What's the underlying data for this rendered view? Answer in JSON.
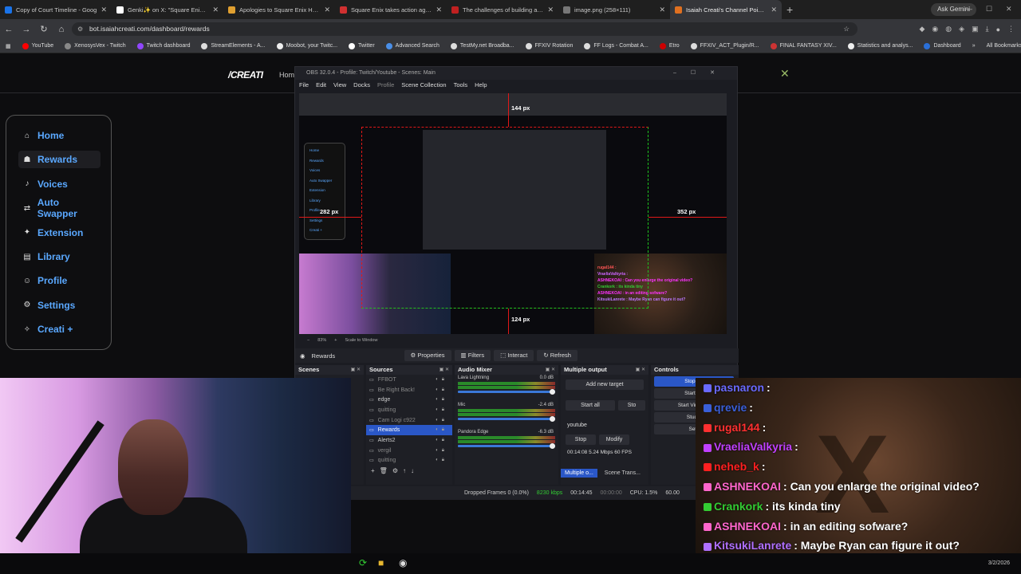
{
  "browser": {
    "tabs": [
      {
        "title": "Copy of Court Timeline - Goog",
        "color": "#1a73e8"
      },
      {
        "title": "Genki✨ on X: \"Square Enix ha",
        "color": "#ffffff"
      },
      {
        "title": "Apologies to Square Enix Holdi",
        "color": "#e0a030"
      },
      {
        "title": "Square Enix takes action again",
        "color": "#d03030"
      },
      {
        "title": "The challenges of building a so",
        "color": "#c02020"
      },
      {
        "title": "image.png (258×111)",
        "color": "#777777"
      },
      {
        "title": "Isaiah Creati's Channel Point Bo",
        "color": "#e07020"
      }
    ],
    "ask_gemini": "Ask Gemini",
    "url": "bot.isaiahcreati.com/dashboard/rewards",
    "bookmarks": [
      "YouTube",
      "XenosysVex - Twitch",
      "Twitch dashboard",
      "StreamElements - A...",
      "Moobot, your Twitc...",
      "Twitter",
      "Advanced Search",
      "TestMy.net Broadba...",
      "FFXIV Rotation",
      "FF Logs - Combat A...",
      "Etro",
      "FFXIV_ACT_Plugin/R...",
      "FINAL FANTASY XIV...",
      "Statistics and analys...",
      "Dashboard"
    ],
    "all_bookmarks": "All Bookmarks"
  },
  "site": {
    "brand": "/CREATI",
    "home_link": "Home",
    "nav": [
      {
        "label": "Home",
        "icon": "home-icon",
        "glyph": "⌂"
      },
      {
        "label": "Rewards",
        "icon": "hat-icon",
        "glyph": "☗"
      },
      {
        "label": "Voices",
        "icon": "mic-icon",
        "glyph": "♪"
      },
      {
        "label": "Auto Swapper",
        "icon": "swap-icon",
        "glyph": "⇄"
      },
      {
        "label": "Extension",
        "icon": "puzzle-icon",
        "glyph": "✦"
      },
      {
        "label": "Library",
        "icon": "book-icon",
        "glyph": "▤"
      },
      {
        "label": "Profile",
        "icon": "user-icon",
        "glyph": "☺"
      },
      {
        "label": "Settings",
        "icon": "gear-icon",
        "glyph": "⚙"
      },
      {
        "label": "Creati +",
        "icon": "creati-logo-icon",
        "glyph": "✧"
      }
    ],
    "active": "Rewards"
  },
  "obs": {
    "title": "OBS 32.0.4 - Profile: Twitch/Youtube - Scenes: Main",
    "menu": [
      "File",
      "Edit",
      "View",
      "Docks",
      "Profile",
      "Scene Collection",
      "Tools",
      "Help"
    ],
    "measurements": {
      "top": "144 px",
      "left": "282 px",
      "right": "352 px",
      "bottom": "124 px"
    },
    "zoom": "83%",
    "scale_mode": "Scale to Window",
    "selected_source": "Rewards",
    "source_buttons": [
      "Properties",
      "Filters",
      "Interact",
      "Refresh"
    ],
    "docks": {
      "scenes": "Scenes",
      "sources": "Sources",
      "audio": "Audio Mixer",
      "multi": "Multiple output",
      "controls": "Controls"
    },
    "sources": [
      "FFBOT",
      "Be Right Back!",
      "edge",
      "quitting",
      "Cam Logi c922",
      "Rewards",
      "Alerts2",
      "vergil",
      "quitting"
    ],
    "audio": [
      {
        "name": "Lava Lightning",
        "db": "0.0 dB"
      },
      {
        "name": "Mic",
        "db": "-2.4 dB"
      },
      {
        "name": "Pandora Edge",
        "db": "-6.3 dB"
      }
    ],
    "multi": {
      "add": "Add new target",
      "start_all": "Start all",
      "stop_all": "Sto",
      "target": "youtube",
      "stop": "Stop",
      "modify": "Modify",
      "stats": "00:14:08  5.24 Mbps  60 FPS"
    },
    "controls": [
      "Stop Str",
      "Start Re",
      "Start Virtual C",
      "Studio",
      "Setti"
    ],
    "bottom_tabs": [
      "Multiple o...",
      "Scene Trans..."
    ],
    "status": {
      "dropped": "Dropped Frames 0 (0.0%)",
      "kbps": "8230 kbps",
      "live": "00:14:45",
      "rec": "00:00:00",
      "cpu": "CPU: 1.5%",
      "fps": "60.00"
    }
  },
  "chat": [
    {
      "user": "pasnaron",
      "text": ":",
      "color": "#6a6aff"
    },
    {
      "user": "qrevie",
      "text": ":",
      "color": "#3a5fd8"
    },
    {
      "user": "rugal144",
      "text": ":",
      "color": "#ff3030"
    },
    {
      "user": "VraeliaValkyria",
      "text": ":",
      "color": "#c040ff"
    },
    {
      "user": "neheb_k",
      "text": ":",
      "color": "#ff2020"
    },
    {
      "user": "ASHNEKOAI",
      "text": ": Can you enlarge the original video?",
      "color": "#ff66cc"
    },
    {
      "user": "Crankork",
      "text": ": its kinda tiny",
      "color": "#33cc33"
    },
    {
      "user": "ASHNEKOAI",
      "text": ": in an editing sofware?",
      "color": "#ff66cc"
    },
    {
      "user": "KitsukiLanrete",
      "text": ": Maybe Ryan can figure it out?",
      "color": "#b070ff"
    }
  ],
  "taskbar": {
    "date": "3/2/2026"
  }
}
